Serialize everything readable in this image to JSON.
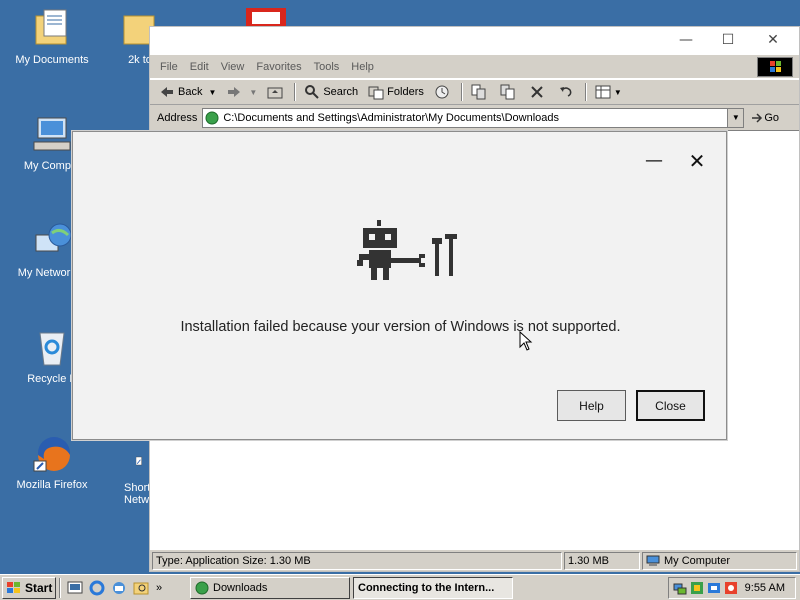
{
  "desktop": {
    "icons": [
      {
        "label": "My Documents",
        "icon": "folder-documents-icon"
      },
      {
        "label": "2k to",
        "icon": "folder-icon"
      },
      {
        "label": "My Comput",
        "icon": "computer-icon"
      },
      {
        "label": "My Network P",
        "icon": "network-icon"
      },
      {
        "label": "Recycle B",
        "icon": "recycle-bin-icon"
      },
      {
        "label": "Mozilla Firefox",
        "icon": "firefox-icon"
      },
      {
        "label": "Short",
        "label2": "Netw",
        "icon": "shortcut-icon"
      }
    ]
  },
  "explorer": {
    "menu": [
      "File",
      "Edit",
      "View",
      "Favorites",
      "Tools",
      "Help"
    ],
    "toolbar": {
      "back": "Back",
      "search": "Search",
      "folders": "Folders"
    },
    "address_label": "Address",
    "address_value": "C:\\Documents and Settings\\Administrator\\My Documents\\Downloads",
    "go": "Go",
    "status": {
      "left": "Type: Application Size: 1.30 MB",
      "size": "1.30 MB",
      "zone": "My Computer"
    }
  },
  "dialog": {
    "message": "Installation failed because your version of Windows is not supported.",
    "help_button": "Help",
    "close_button": "Close",
    "minimize_glyph": "—",
    "close_glyph": "✕",
    "art": "robot-with-tools-icon"
  },
  "taskbar": {
    "start": "Start",
    "tasks": [
      {
        "label": "Downloads",
        "active": false
      },
      {
        "label": "Connecting to the Intern...",
        "active": true
      }
    ],
    "clock": "9:55 AM"
  }
}
